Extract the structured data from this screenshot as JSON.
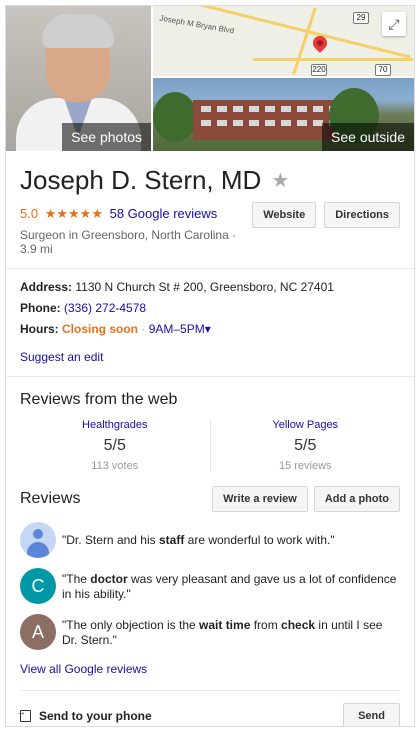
{
  "hero": {
    "photos_label": "See photos",
    "outside_label": "See outside",
    "map": {
      "street_label": "Joseph M Bryan Blvd",
      "route_labels": [
        "29",
        "70",
        "220"
      ]
    }
  },
  "place": {
    "name": "Joseph D. Stern, MD",
    "rating": "5.0",
    "stars": "★★★★★",
    "review_count_label": "58 Google reviews",
    "category_line": "Surgeon in Greensboro, North Carolina · 3.9 mi"
  },
  "actions": {
    "website": "Website",
    "directions": "Directions"
  },
  "info": {
    "address_label": "Address:",
    "address": "1130 N Church St # 200, Greensboro, NC 27401",
    "phone_label": "Phone:",
    "phone": "(336) 272-4578",
    "hours_label": "Hours:",
    "hours_status": "Closing soon",
    "hours_range": "9AM–5PM",
    "suggest_edit": "Suggest an edit"
  },
  "web_reviews": {
    "heading": "Reviews from the web",
    "sources": [
      {
        "name": "Healthgrades",
        "score": "5/5",
        "count": "113 votes"
      },
      {
        "name": "Yellow Pages",
        "score": "5/5",
        "count": "15 reviews"
      }
    ]
  },
  "reviews": {
    "heading": "Reviews",
    "write_review": "Write a review",
    "add_photo": "Add a photo",
    "items": [
      {
        "avatar": "",
        "pre": "\"Dr. Stern and his ",
        "b1": "staff",
        "mid": " are wonderful to work with.\"",
        "b2": "",
        "post": "",
        "b3": "",
        "tail": ""
      },
      {
        "avatar": "C",
        "pre": "\"The ",
        "b1": "doctor",
        "mid": " was very pleasant and gave us a lot of confidence in his ability.\"",
        "b2": "",
        "post": "",
        "b3": "",
        "tail": ""
      },
      {
        "avatar": "A",
        "pre": "\"The only objection is the ",
        "b1": "wait time",
        "mid": " from ",
        "b2": "check",
        "post": " in until I see Dr. Stern.\"",
        "b3": "",
        "tail": ""
      }
    ],
    "view_all": "View all Google reviews"
  },
  "send": {
    "label": "Send to your phone",
    "button": "Send"
  }
}
